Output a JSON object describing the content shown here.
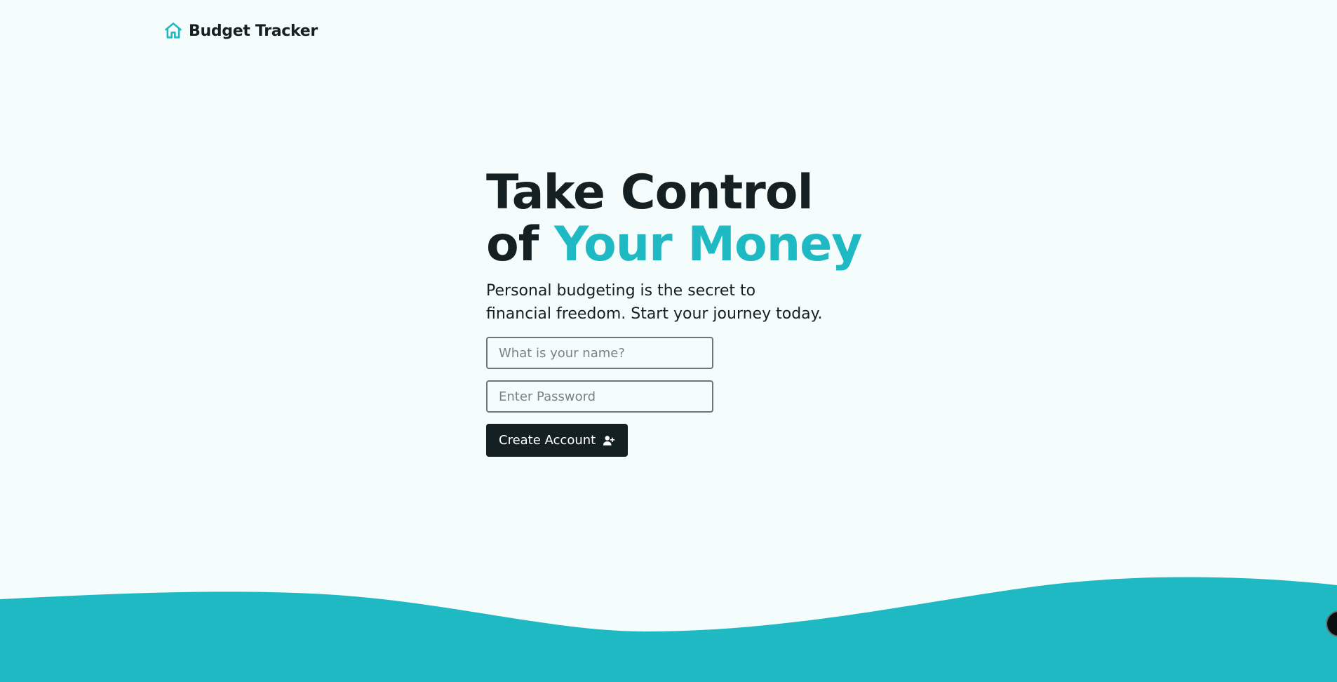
{
  "nav": {
    "brand": "Budget Tracker",
    "icon": "home-icon"
  },
  "hero": {
    "title_line1": "Take Control",
    "title_line2_prefix": "of",
    "title_line2_accent": "Your Money",
    "lead": "Personal budgeting is the secret to financial freedom. Start your journey today."
  },
  "form": {
    "name_placeholder": "What is your name?",
    "name_value": "",
    "password_placeholder": "Enter Password",
    "password_value": "",
    "submit_label": "Create Account",
    "submit_icon": "user-plus-icon"
  },
  "colors": {
    "accent": "#1fb9c3",
    "dark": "#142022",
    "background": "#f5fcfc"
  }
}
